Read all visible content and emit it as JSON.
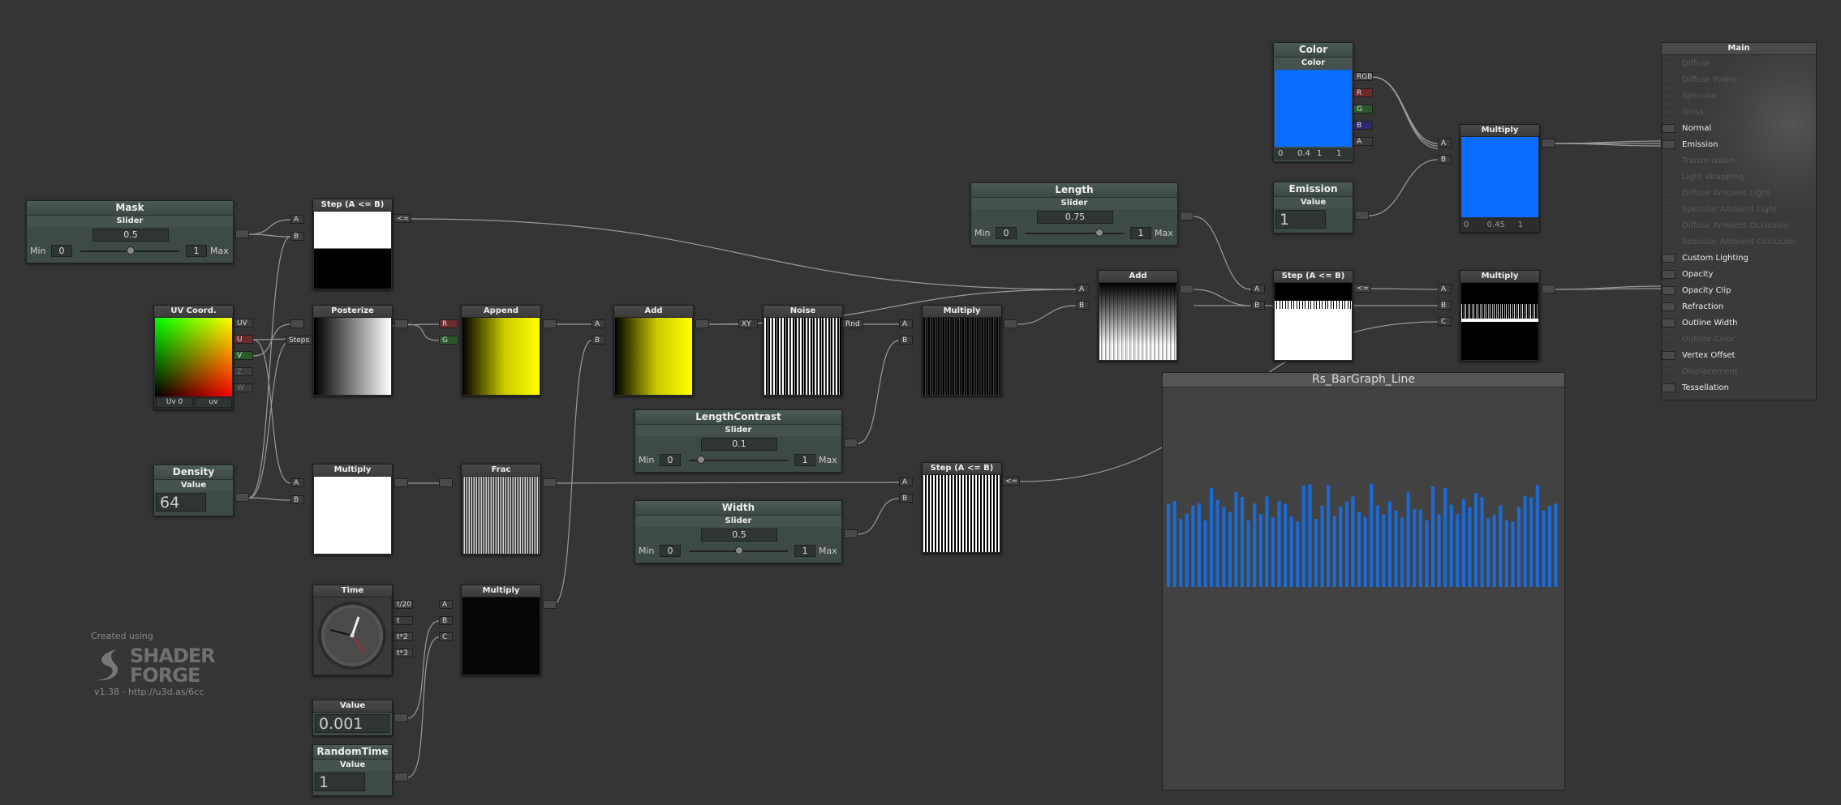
{
  "nodes": {
    "mask": {
      "title": "Mask",
      "sub": "Slider",
      "value": "0.5",
      "min_label": "Min",
      "min": "0",
      "max": "1",
      "max_label": "Max",
      "knob": 0.5
    },
    "uv_coord": {
      "title": "UV Coord.",
      "outputs": [
        "UV",
        "U",
        "V",
        "Z",
        "W"
      ],
      "uv_index": "Uv 0",
      "uv_mode": "uv"
    },
    "density": {
      "title": "Density",
      "sub": "Value",
      "value": "64"
    },
    "step1": {
      "title": "Step (A <= B)",
      "in_a": "A",
      "in_b": "B",
      "out": "<="
    },
    "posterize": {
      "title": "Posterize",
      "in_steps": "Steps"
    },
    "multiply1": {
      "title": "Multiply",
      "in_a": "A",
      "in_b": "B"
    },
    "time": {
      "title": "Time",
      "outputs": [
        "t/20",
        "t",
        "t*2",
        "t*3"
      ]
    },
    "value_small": {
      "title": "Value",
      "value": "0.001"
    },
    "randomtime": {
      "title": "RandomTime",
      "sub": "Value",
      "value": "1"
    },
    "append": {
      "title": "Append",
      "in_r": "R",
      "in_g": "G"
    },
    "frac": {
      "title": "Frac"
    },
    "multiply2": {
      "title": "Multiply",
      "in_a": "A",
      "in_b": "B",
      "in_c": "C"
    },
    "add1": {
      "title": "Add",
      "in_a": "A",
      "in_b": "B"
    },
    "noise": {
      "title": "Noise",
      "in_xy": "XY",
      "out": "Rnd"
    },
    "lengthcontrast": {
      "title": "LengthContrast",
      "sub": "Slider",
      "value": "0.1",
      "min_label": "Min",
      "min": "0",
      "max": "1",
      "max_label": "Max",
      "knob": 0.1
    },
    "width": {
      "title": "Width",
      "sub": "Slider",
      "value": "0.5",
      "min_label": "Min",
      "min": "0",
      "max": "1",
      "max_label": "Max",
      "knob": 0.5
    },
    "multiply3": {
      "title": "Multiply",
      "in_a": "A",
      "in_b": "B"
    },
    "step3": {
      "title": "Step (A <= B)",
      "in_a": "A",
      "in_b": "B",
      "out": "<="
    },
    "length": {
      "title": "Length",
      "sub": "Slider",
      "value": "0.75",
      "min_label": "Min",
      "min": "0",
      "max": "1",
      "max_label": "Max",
      "knob": 0.75
    },
    "add2": {
      "title": "Add",
      "in_a": "A",
      "in_b": "B"
    },
    "color": {
      "title": "Color",
      "sub": "Color",
      "outputs": [
        "RGB",
        "R",
        "G",
        "B",
        "A"
      ],
      "swatch": "#0a6dff",
      "channels": [
        "0",
        "0.4",
        "1",
        "1"
      ]
    },
    "emission": {
      "title": "Emission",
      "sub": "Value",
      "value": "1"
    },
    "step2": {
      "title": "Step (A <= B)",
      "in_a": "A",
      "in_b": "B",
      "out": "<="
    },
    "multiply4": {
      "title": "Multiply",
      "in_a": "A",
      "in_b": "B",
      "swatch": "#0a6dff",
      "readout": "0       0.45     1"
    },
    "multiply5": {
      "title": "Multiply",
      "in_a": "A",
      "in_b": "B",
      "in_c": "C"
    }
  },
  "preview": {
    "title": "Rs_BarGraph_Line",
    "bar_color": "#1a6ad8"
  },
  "main": {
    "title": "Main",
    "inputs": [
      {
        "label": "Diffuse",
        "enabled": false
      },
      {
        "label": "Diffuse Power",
        "enabled": false
      },
      {
        "label": "Specular",
        "enabled": false
      },
      {
        "label": "Gloss",
        "enabled": false
      },
      {
        "label": "Normal",
        "enabled": true
      },
      {
        "label": "Emission",
        "enabled": true
      },
      {
        "label": "Transmission",
        "enabled": false
      },
      {
        "label": "Light Wrapping",
        "enabled": false
      },
      {
        "label": "Diffuse Ambient Light",
        "enabled": false
      },
      {
        "label": "Specular Ambient Light",
        "enabled": false
      },
      {
        "label": "Diffuse Ambient Occlusion",
        "enabled": false
      },
      {
        "label": "Specular Ambient Occlusion",
        "enabled": false
      },
      {
        "label": "Custom Lighting",
        "enabled": true
      },
      {
        "label": "Opacity",
        "enabled": true
      },
      {
        "label": "Opacity Clip",
        "enabled": true
      },
      {
        "label": "Refraction",
        "enabled": true
      },
      {
        "label": "Outline Width",
        "enabled": true
      },
      {
        "label": "Outline Color",
        "enabled": false
      },
      {
        "label": "Vertex Offset",
        "enabled": true
      },
      {
        "label": "Displacement",
        "enabled": false
      },
      {
        "label": "Tessellation",
        "enabled": true
      }
    ]
  },
  "logo": {
    "created": "Created using",
    "line1": "SHADER",
    "line2": "FORGE",
    "version": "v1.38 - http://u3d.as/6cc"
  }
}
